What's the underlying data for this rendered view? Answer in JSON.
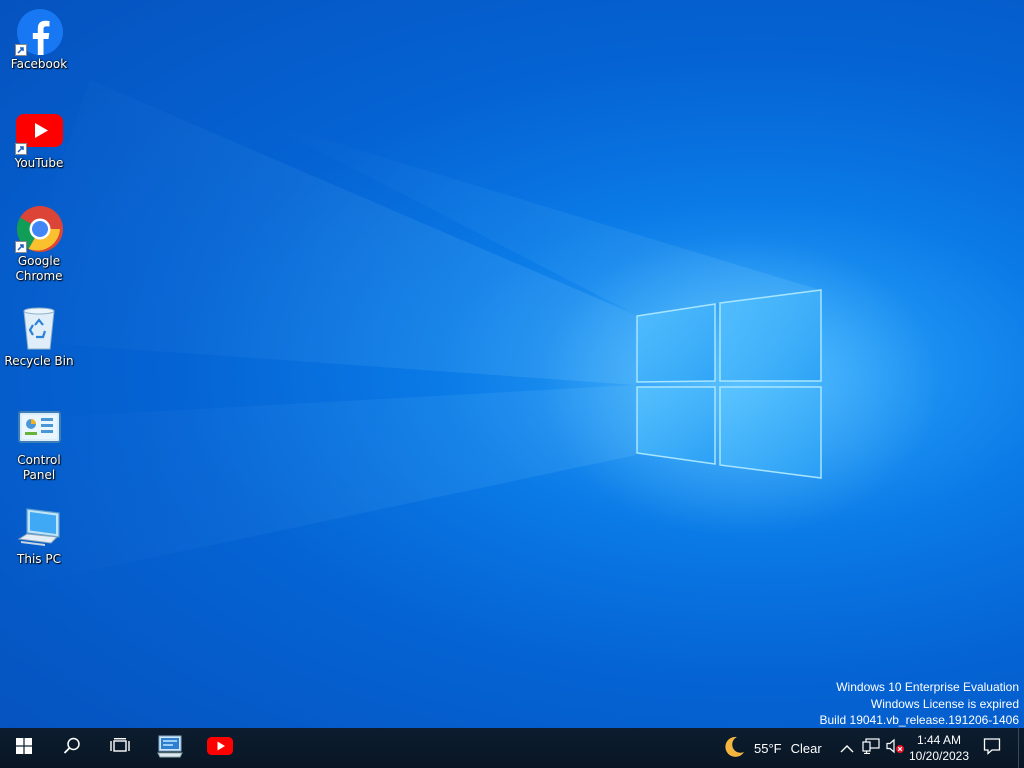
{
  "desktop": {
    "icons": [
      {
        "label": "Facebook",
        "icon": "facebook-icon"
      },
      {
        "label": "YouTube",
        "icon": "youtube-icon"
      },
      {
        "label": "Google Chrome",
        "icon": "chrome-icon"
      },
      {
        "label": "Recycle Bin",
        "icon": "recycle-bin-icon"
      },
      {
        "label": "Control Panel",
        "icon": "control-panel-icon"
      },
      {
        "label": "This PC",
        "icon": "this-pc-icon"
      }
    ]
  },
  "watermark": {
    "line1": "Windows 10 Enterprise Evaluation",
    "line2": "Windows License is expired",
    "line3": "Build 19041.vb_release.191206-1406"
  },
  "taskbar": {
    "pinned": [
      {
        "icon": "windows-start-icon"
      },
      {
        "icon": "search-icon"
      },
      {
        "icon": "task-view-icon"
      },
      {
        "icon": "remote-desktop-icon"
      },
      {
        "icon": "youtube-icon"
      }
    ],
    "weather": {
      "icon": "moon-icon",
      "temperature": "55°F",
      "condition": "Clear"
    },
    "tray": {
      "icons": [
        "chevron-up-icon",
        "network-icon",
        "volume-muted-icon"
      ]
    },
    "clock": {
      "time": "1:44 AM",
      "date": "10/20/2023"
    },
    "notification_icon": "notification-icon"
  },
  "colors": {
    "wallpaper_base": "#0563d3",
    "wallpaper_glow": "#2fa8ff",
    "taskbar": "#0b1a2a",
    "youtube_red": "#ff0000",
    "facebook_blue": "#1877f2"
  }
}
